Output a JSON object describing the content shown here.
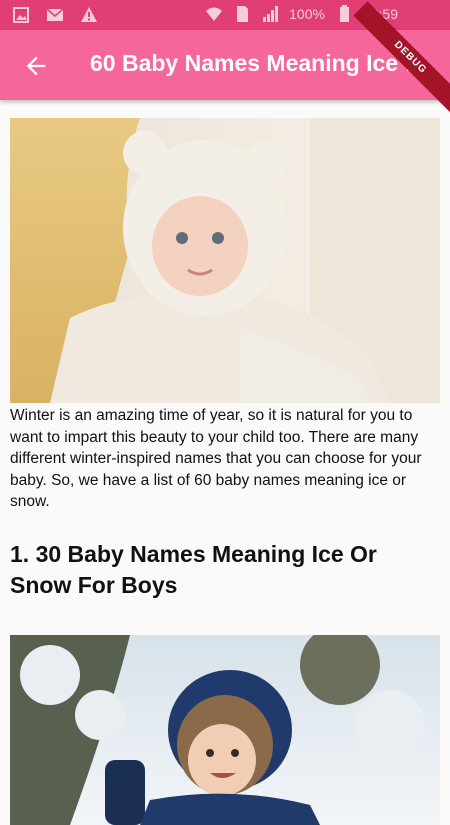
{
  "status_bar": {
    "battery_percent": "100%",
    "time": "12:59",
    "icons": [
      "image-icon",
      "mail-icon",
      "warning-icon",
      "wifi-icon",
      "sim-icon",
      "signal-icon",
      "battery-icon"
    ]
  },
  "app_bar": {
    "title": "60 Baby Names Meaning Ice Or Snow",
    "back_icon": "arrow-left-icon",
    "background_color": "#f5679a",
    "debug_banner": "DEBUG"
  },
  "article": {
    "intro": "Winter is an amazing time of year, so it is natural for you to want to impart this beauty to your child too. There are many different winter-inspired names that you can choose for your baby. So, we have a list of 60 baby names meaning ice or snow.",
    "section_heading": "1. 30 Baby Names Meaning Ice Or Snow For Boys"
  }
}
